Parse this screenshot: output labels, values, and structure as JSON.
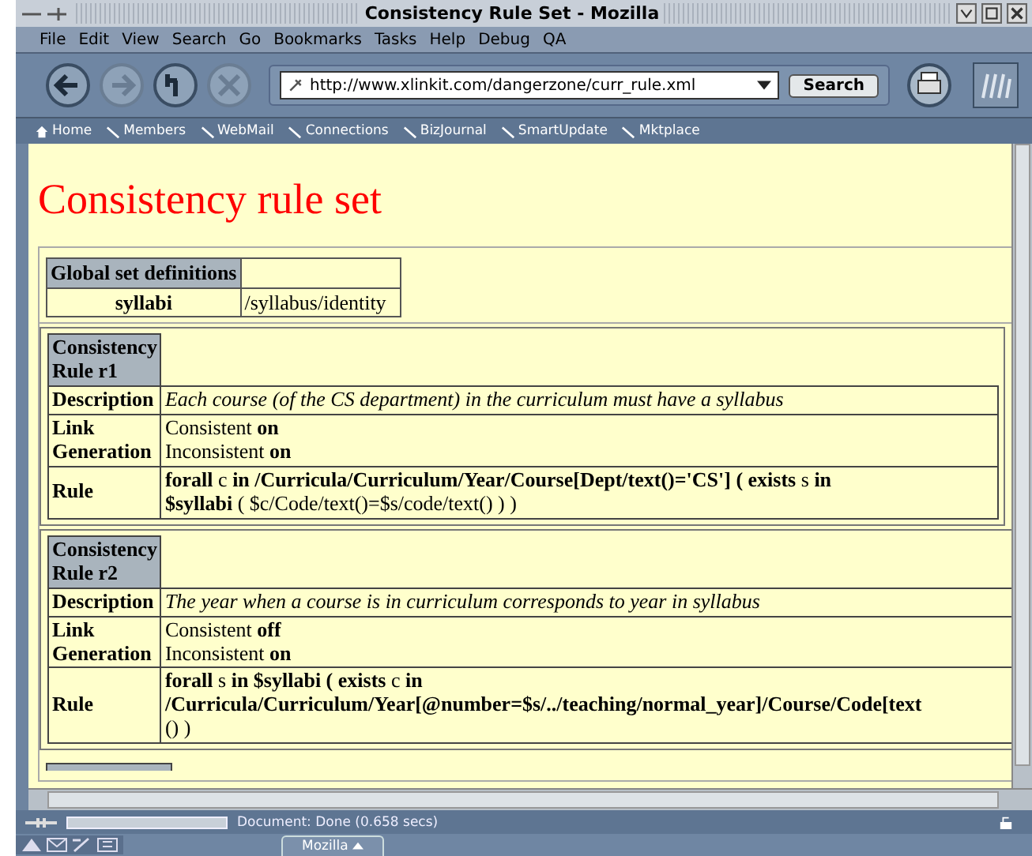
{
  "window": {
    "title": "Consistency Rule Set - Mozilla"
  },
  "menu": [
    {
      "label": "File"
    },
    {
      "label": "Edit"
    },
    {
      "label": "View"
    },
    {
      "label": "Search"
    },
    {
      "label": "Go"
    },
    {
      "label": "Bookmarks"
    },
    {
      "label": "Tasks"
    },
    {
      "label": "Help"
    },
    {
      "label": "Debug"
    },
    {
      "label": "QA"
    }
  ],
  "address": {
    "value": "http://www.xlinkit.com/dangerzone/curr_rule.xml"
  },
  "search_button": "Search",
  "bookmarks": [
    {
      "label": "Home",
      "kind": "home"
    },
    {
      "label": "Members",
      "kind": "link"
    },
    {
      "label": "WebMail",
      "kind": "link"
    },
    {
      "label": "Connections",
      "kind": "link"
    },
    {
      "label": "BizJournal",
      "kind": "link"
    },
    {
      "label": "SmartUpdate",
      "kind": "link"
    },
    {
      "label": "Mktplace",
      "kind": "link"
    }
  ],
  "page": {
    "heading": "Consistency rule set",
    "global": {
      "header": "Global set definitions",
      "rows": [
        {
          "name": "syllabi",
          "value": "/syllabus/identity"
        }
      ]
    },
    "rules": [
      {
        "title": [
          "Consistency",
          "Rule r1"
        ],
        "desc_label": "Description",
        "description": "Each course (of the CS department) in the curriculum must have a syllabus",
        "link_label": [
          "Link",
          "Generation"
        ],
        "link": [
          "Consistent **on**",
          "Inconsistent **on**"
        ],
        "rule_label": "Rule",
        "rule": [
          "**forall** c **in /Curricula/Curriculum/Year/Course[Dept/text()='CS'] ( exists** s **in**",
          "**$syllabi** ( $c/Code/text()=$s/code/text() ) )"
        ]
      },
      {
        "title": [
          "Consistency",
          "Rule r2"
        ],
        "desc_label": "Description",
        "description": "The year when a course is in curriculum corresponds to year in syllabus",
        "link_label": [
          "Link",
          "Generation"
        ],
        "link": [
          "Consistent **off**",
          "Inconsistent **on**"
        ],
        "rule_label": "Rule",
        "rule": [
          "**forall** s **in $syllabi ( exists** c **in**",
          "**/Curricula/Curriculum/Year[@number=$s/../teaching/normal_year]/Course/Code[text**",
          "() )"
        ]
      }
    ]
  },
  "status_bar": {
    "progress": {
      "level": 0
    },
    "text": "Document: Done (0.658 secs)"
  },
  "taskbar": {
    "task": "Mozilla"
  }
}
